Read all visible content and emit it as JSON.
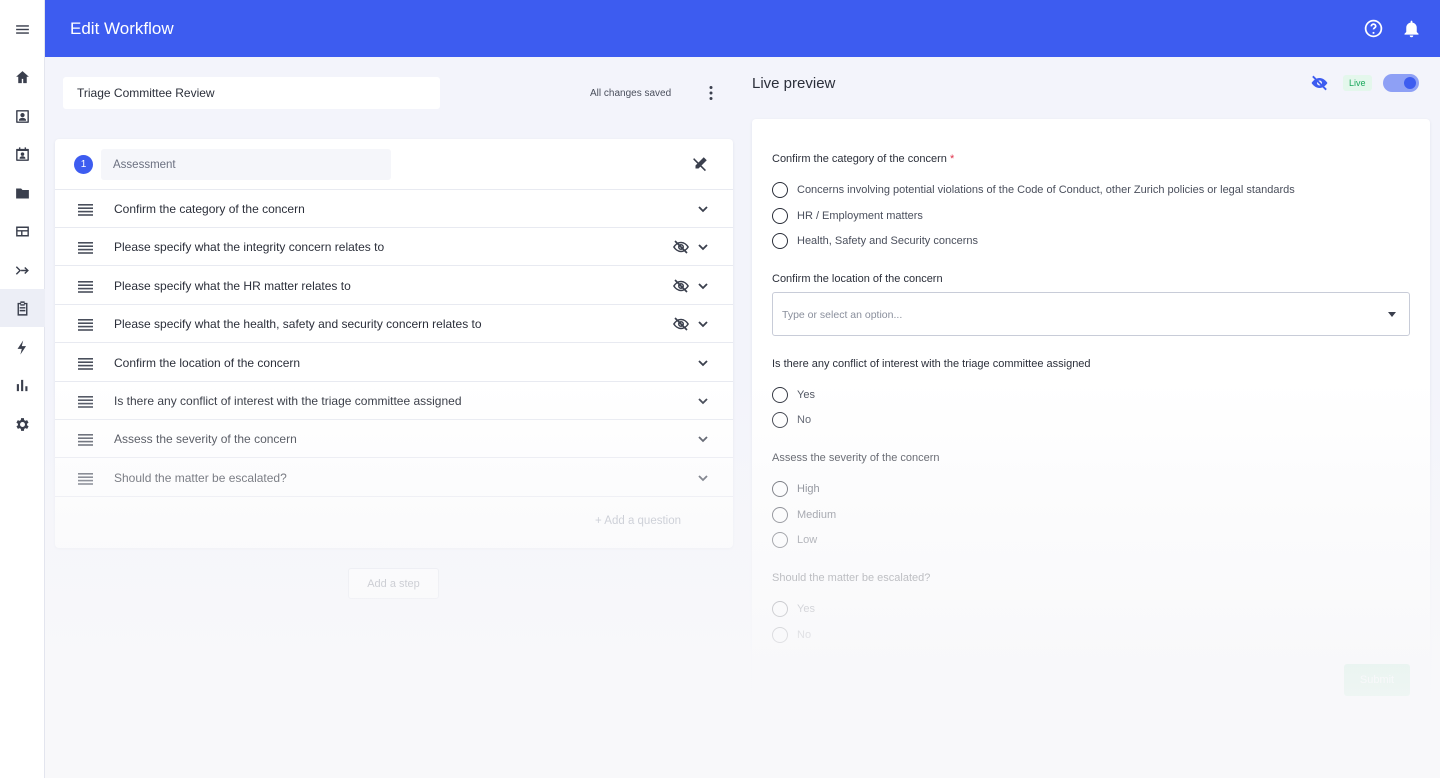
{
  "header": {
    "title": "Edit Workflow",
    "icons": [
      "help-circle-icon",
      "bell-icon"
    ],
    "accent": "#3d5cf0"
  },
  "sidebar": {
    "items": [
      {
        "icon": "menu-icon"
      },
      {
        "icon": "home-icon"
      },
      {
        "icon": "contact-card-icon"
      },
      {
        "icon": "calendar-person-icon"
      },
      {
        "icon": "folder-icon"
      },
      {
        "icon": "table-icon"
      },
      {
        "icon": "merge-arrow-icon"
      },
      {
        "icon": "clipboard-icon",
        "active": true
      },
      {
        "icon": "lightning-icon"
      },
      {
        "icon": "bar-chart-icon"
      },
      {
        "icon": "settings-gear-icon"
      }
    ]
  },
  "editor": {
    "workflow_name": "Triage Committee Review",
    "save_status": "All changes saved",
    "step": {
      "number": "1",
      "name": "Assessment"
    },
    "questions": [
      {
        "label": "Confirm the category of the concern",
        "hidden": false
      },
      {
        "label": "Please specify what the integrity concern relates to",
        "hidden": true
      },
      {
        "label": "Please specify what the HR matter relates to",
        "hidden": true
      },
      {
        "label": "Please specify what the health, safety and security concern relates to",
        "hidden": true
      },
      {
        "label": "Confirm the location of the concern",
        "hidden": false
      },
      {
        "label": "Is there any conflict of interest with the triage committee assigned",
        "hidden": false
      },
      {
        "label": "Assess the severity of the concern",
        "hidden": false
      },
      {
        "label": "Should the matter be escalated?",
        "hidden": false
      }
    ],
    "add_question_label": "Add a question",
    "add_step_label": "Add a step"
  },
  "preview": {
    "title": "Live preview",
    "live_badge": "Live",
    "live_on": true,
    "q1": {
      "label": "Confirm the category of the concern",
      "required_mark": "*",
      "options": [
        "Concerns involving potential violations of the Code of Conduct, other Zurich policies or legal standards",
        "HR / Employment matters",
        "Health, Safety and Security concerns"
      ]
    },
    "q2": {
      "label": "Confirm the location of the concern",
      "placeholder": "Type or select an option..."
    },
    "q3": {
      "label": "Is there any conflict of interest with the triage committee assigned",
      "options": [
        "Yes",
        "No"
      ]
    },
    "q4": {
      "label": "Assess the severity of the concern",
      "options": [
        "High",
        "Medium",
        "Low"
      ]
    },
    "q5": {
      "label": "Should the matter be escalated?",
      "options": [
        "Yes",
        "No"
      ]
    },
    "submit_label": "Submit",
    "submit_color": "#2bc46f"
  }
}
